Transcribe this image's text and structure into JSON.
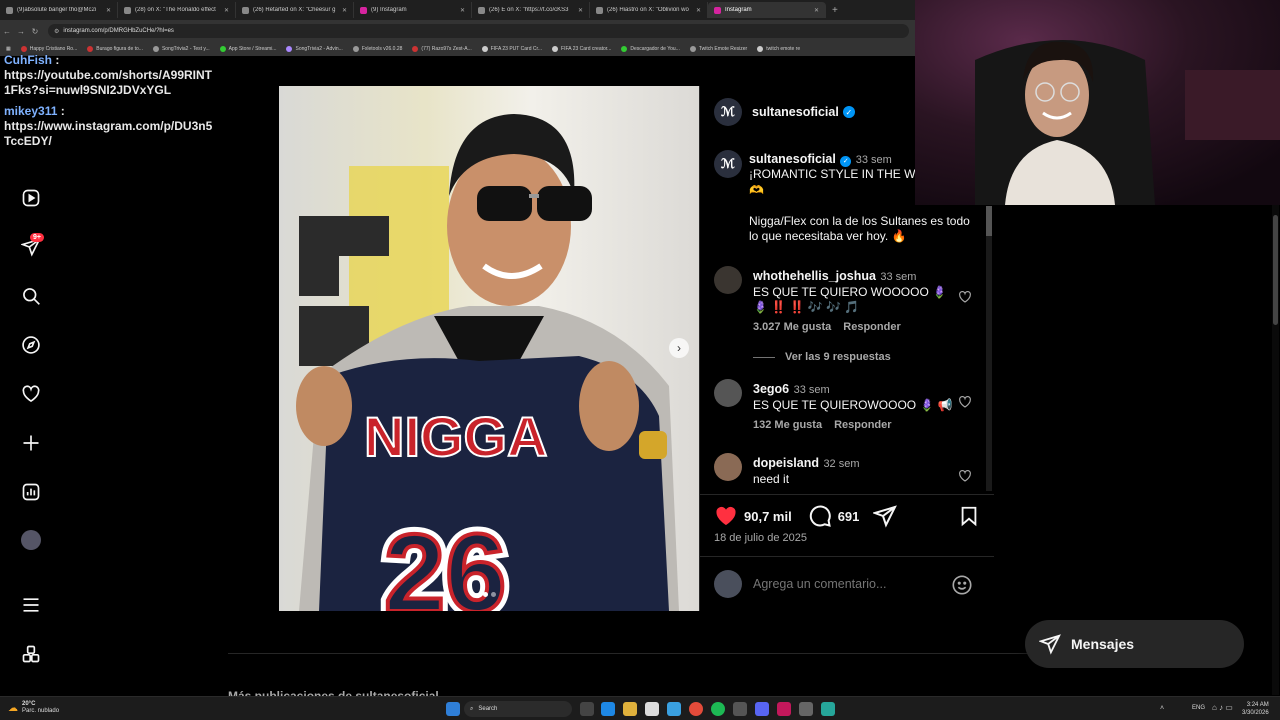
{
  "browser": {
    "tabs": [
      {
        "label": "(9)absolute banger tho@Mc2i",
        "active": false
      },
      {
        "label": "(28) on X: \"The Ronaldo effect",
        "active": false
      },
      {
        "label": "(26) Retarted on X: \"Cheesur g",
        "active": false
      },
      {
        "label": "(9) Instagram",
        "active": false
      },
      {
        "label": "(26) E on X: \"https://t.co/cKS3",
        "active": false
      },
      {
        "label": "(26) Hiastro on X: \"Oblivion wo",
        "active": false
      },
      {
        "label": "Instagram",
        "active": true
      }
    ],
    "new_tab": "+",
    "url": "instagram.com/p/DMRGHbZuCHe/?hl=es",
    "bookmarks": [
      "Happy Cristiano Ro...",
      "Burago figura de to...",
      "SongTrivia2 - Test y...",
      "App Store / Streami...",
      "SongTrivia2 - Advin...",
      "Fxletools v26.0.28",
      "(77) Razo97s Zest-A...",
      "FIFA 23 PUT Card Cr...",
      "FIFA 23 Card creator...",
      "Descargador de You...",
      "Twitch Emote Resizer",
      "twitch emote re"
    ]
  },
  "chat": [
    {
      "user": "CuhFish",
      "sep": " :",
      "message": "https://youtube.com/shorts/A99RINT1Fks?si=nuwl9SNI2JDVxYGL"
    },
    {
      "user": "mikey311",
      "sep": " :",
      "message": "https://www.instagram.com/p/DU3n5TccEDY/"
    }
  ],
  "sidebar": {
    "notification_count": "9+"
  },
  "post": {
    "author": "sultanesoficial",
    "verified": true,
    "caption_time": "33 sem",
    "caption_line1": "¡ROMANTIC STYLE IN THE WO",
    "caption_emoji": "🫶",
    "caption_body": "Nigga/Flex con la de los Sultanes es todo lo que necesitaba ver hoy. 🔥",
    "jersey_text": "NIGGA",
    "jersey_number": "26",
    "comments": [
      {
        "user": "whothehellis_joshua",
        "time": "33 sem",
        "text": "ES QUE TE QUIERO WOOOOO 🪻",
        "text2": "🪻 ‼️ ‼️ 🎶 🎶 🎵",
        "likes": "3.027 Me gusta",
        "reply": "Responder",
        "view_replies": "Ver las 9 respuestas"
      },
      {
        "user": "3ego6",
        "time": "33 sem",
        "text": "ES QUE TE QUIEROWOOOO 🪻 📢",
        "likes": "132 Me gusta",
        "reply": "Responder"
      },
      {
        "user": "dopeisland",
        "time": "32 sem",
        "text": "need it"
      }
    ],
    "like_count": "90,7 mil",
    "comment_count": "691",
    "date": "18 de julio de 2025",
    "comment_placeholder": "Agrega un comentario..."
  },
  "messages_button": "Mensajes",
  "more_posts_label": "Más publicaciones de sultanesoficial",
  "taskbar": {
    "weather_temp": "20°C",
    "weather_desc": "Parc. nublado",
    "search": "Search",
    "lang": "ENG",
    "time": "3:24 AM",
    "date": "3/30/2026"
  },
  "colors": {
    "like_red": "#ff3040",
    "verified_blue": "#0095f6",
    "bg": "#000000"
  }
}
